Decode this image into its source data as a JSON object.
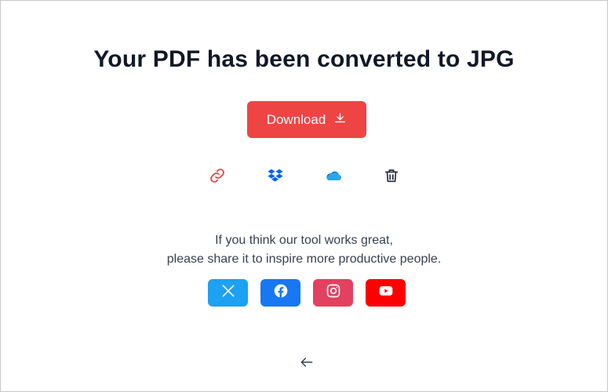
{
  "title": "Your PDF has been converted to JPG",
  "download": {
    "label": "Download",
    "icon": "download-icon"
  },
  "actions": [
    {
      "name": "copy-link",
      "icon": "link-icon",
      "color": "#ef4444"
    },
    {
      "name": "save-to-dropbox",
      "icon": "dropbox-icon",
      "color": "#0061fe"
    },
    {
      "name": "save-to-onedrive",
      "icon": "onedrive-icon",
      "color": "#0364b8"
    },
    {
      "name": "delete",
      "icon": "trash-icon",
      "color": "#1f2937"
    }
  ],
  "share": {
    "line1": "If you think our tool works great,",
    "line2": "please share it to inspire more productive people."
  },
  "social": [
    {
      "name": "x",
      "icon": "x-icon",
      "color": "#1da1f2"
    },
    {
      "name": "facebook",
      "icon": "facebook-icon",
      "color": "#1877f2"
    },
    {
      "name": "instagram",
      "icon": "instagram-icon",
      "color": "#e4405f"
    },
    {
      "name": "youtube",
      "icon": "youtube-icon",
      "color": "#ff0000"
    }
  ],
  "back": {
    "icon": "arrow-left-icon"
  },
  "colors": {
    "accent": "#ef4444",
    "text": "#111827"
  }
}
